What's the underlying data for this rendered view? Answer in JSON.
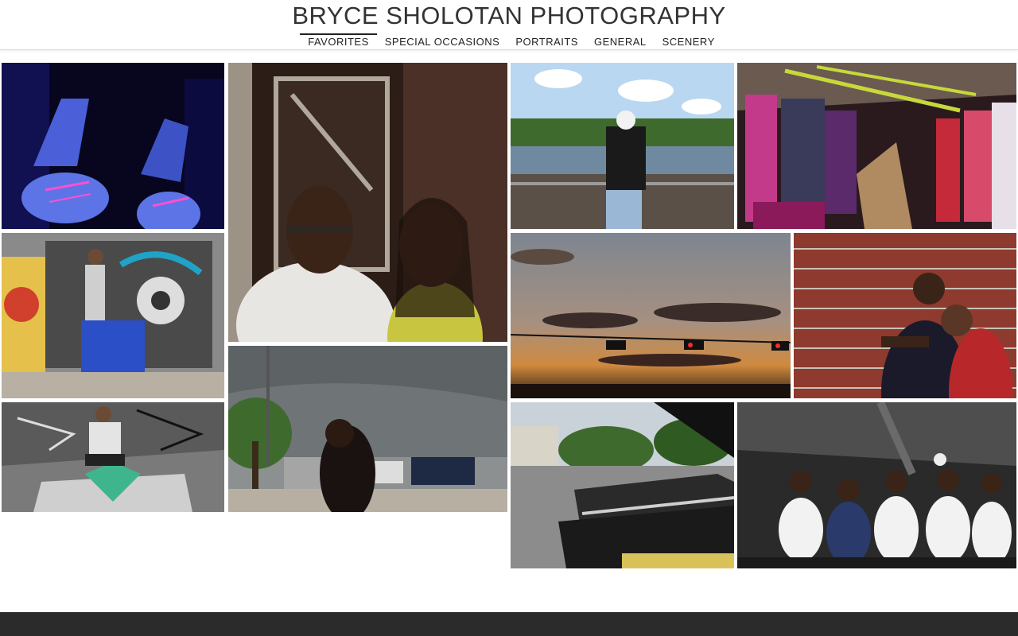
{
  "site": {
    "title": "BRYCE SHOLOTAN PHOTOGRAPHY"
  },
  "nav": {
    "items": [
      {
        "label": "FAVORITES",
        "active": true
      },
      {
        "label": "SPECIAL OCCASIONS",
        "active": false
      },
      {
        "label": "PORTRAITS",
        "active": false
      },
      {
        "label": "GENERAL",
        "active": false
      },
      {
        "label": "SCENERY",
        "active": false
      }
    ]
  },
  "colors": {
    "accent": "#222222",
    "footer": "#2b2b2b",
    "header_border": "#dcdcdc"
  }
}
